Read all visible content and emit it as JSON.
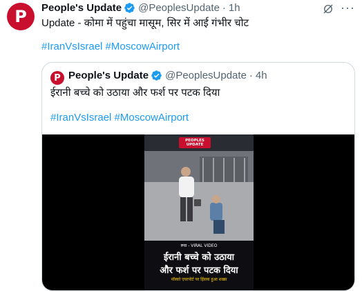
{
  "tweet": {
    "display_name": "People's Update",
    "handle": "@PeoplesUpdate",
    "separator": "·",
    "time": "1h",
    "text": "Update - कोमा में पहुंचा मासूम, सिर में आई गंभीर चोट",
    "hashtags": [
      "#IranVsIsrael",
      "#MoscowAirport"
    ],
    "more_label": "···"
  },
  "quoted": {
    "display_name": "People's Update",
    "handle": "@PeoplesUpdate",
    "separator": "·",
    "time": "4h",
    "text": "ईरानी बच्चे को उठाया और फर्श पर पटक दिया",
    "hashtags": [
      "#IranVsIsrael",
      "#MoscowAirport"
    ],
    "media": {
      "brand_logo": "PEOPLES UPDATE",
      "overlay_small": "रूस - VIRAL VIDEO",
      "overlay_line1": "ईरानी बच्चे को उठाया",
      "overlay_line2": "और फर्श पर पटक दिया",
      "overlay_line3": "मॉस्को एयरपोर्ट पर हिंसक हुआ शख्स"
    }
  },
  "colors": {
    "brand": "#c8102e",
    "link": "#1d9bf0",
    "verified": "#1d9bf0",
    "muted": "#536471"
  },
  "icons": [
    "verified-badge-icon",
    "grok-icon",
    "more-icon"
  ]
}
